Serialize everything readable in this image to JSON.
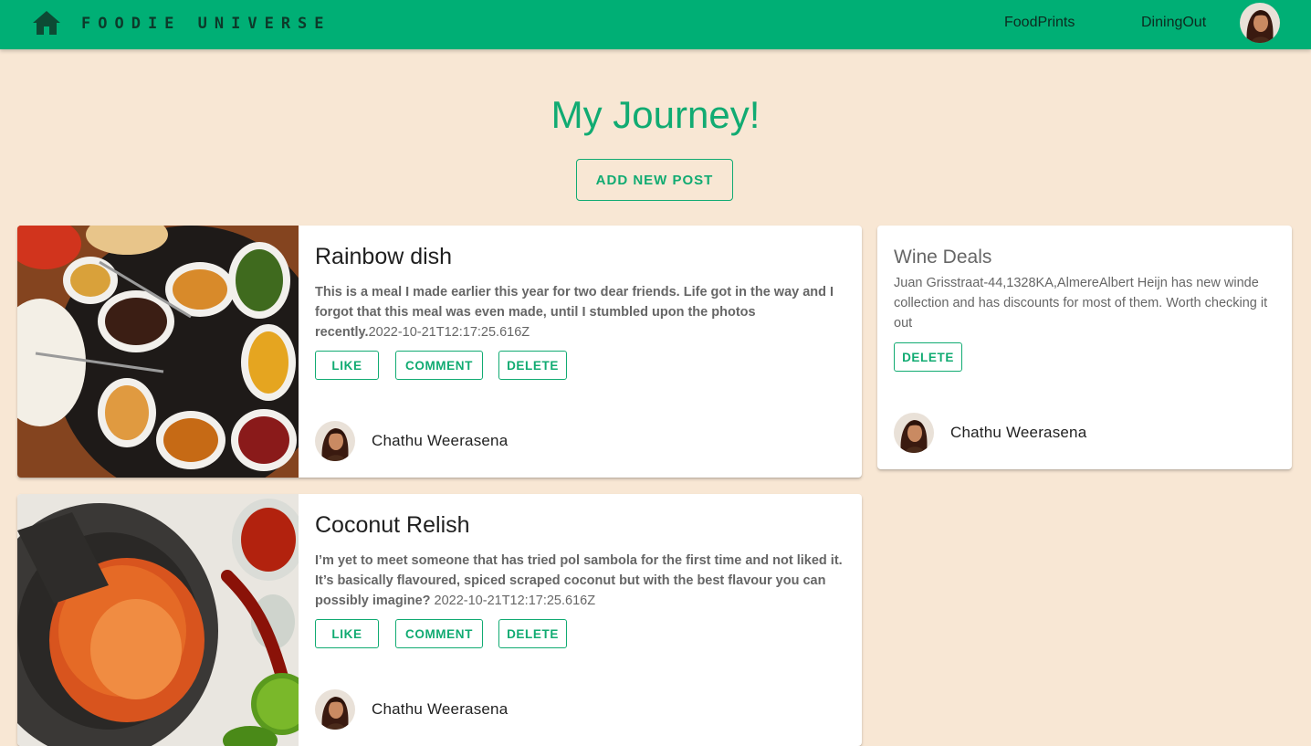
{
  "app": {
    "brand": "FOODIE UNIVERSE",
    "nav": [
      {
        "label": "FoodPrints"
      },
      {
        "label": "DiningOut"
      }
    ],
    "colors": {
      "accent": "#00af75",
      "background": "#f8e7d4",
      "title": "#11ab72"
    }
  },
  "page": {
    "title": "My Journey!",
    "add_post_label": "ADD NEW POST"
  },
  "posts": [
    {
      "title": "Rainbow dish",
      "description": "This is a meal I made earlier this year for two dear friends. Life got in the way and I forgot that this meal was even made, until I stumbled upon the photos recently.",
      "timestamp": "2022-10-21T12:17:25.616Z",
      "like_label": "LIKE",
      "comment_label": "COMMENT",
      "delete_label": "DELETE",
      "author": "Chathu Weerasena",
      "image_icon": "curry-platter-photo"
    },
    {
      "title": "Coconut Relish",
      "description": "I’m yet to meet someone that has tried pol sambola for the first time and not liked it. It’s basically flavoured, spiced scraped coconut but with the best flavour you can possibly imagine?",
      "timestamp": " 2022-10-21T12:17:25.616Z",
      "like_label": "LIKE",
      "comment_label": "COMMENT",
      "delete_label": "DELETE",
      "author": "Chathu Weerasena",
      "image_icon": "coconut-sambol-photo"
    }
  ],
  "deal": {
    "title": "Wine Deals",
    "description": "Juan Grisstraat-44,1328KA,AlmereAlbert Heijn has new winde collection and has discounts for most of them. Worth checking it out",
    "delete_label": "DELETE",
    "author": "Chathu Weerasena"
  }
}
